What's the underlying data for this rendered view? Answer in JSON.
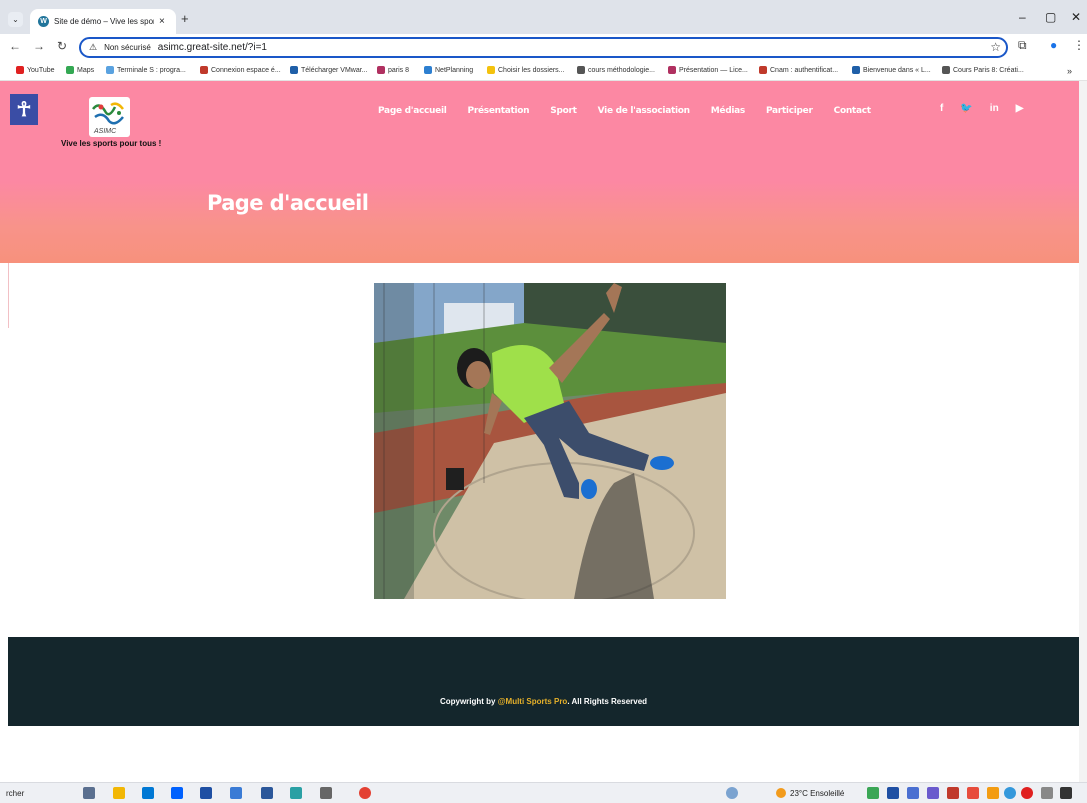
{
  "browser": {
    "tab_title": "Site de démo – Vive les sports p",
    "tab_close": "×",
    "new_tab": "+",
    "security_label": "Non sécurisé",
    "url": "asimc.great-site.net/?i=1",
    "bookmarks": [
      "YouTube",
      "Maps",
      "Terminale S : progra...",
      "Connexion espace é...",
      "Télécharger VMwar...",
      "paris 8",
      "NetPlanning",
      "Choisir les dossiers...",
      "cours méthodologie...",
      "Présentation — Lice...",
      "Cnam : authentificat...",
      "Bienvenue dans « L...",
      "Cours Paris 8: Créati..."
    ],
    "bookmarks_overflow": "»"
  },
  "site": {
    "logo_text": "ASIMC",
    "tagline": "Vive les sports pour tous !",
    "nav": [
      "Page d'accueil",
      "Présentation",
      "Sport",
      "Vie de l'association",
      "Médias",
      "Participer",
      "Contact"
    ],
    "social": [
      "f",
      "🐦",
      "in",
      "▶"
    ],
    "page_heading": "Page d'accueil",
    "photo_alt": "Athlète lançant un disque",
    "footer": {
      "prefix": "Copywright by ",
      "brand": "@Multi Sports Pro",
      "suffix": ". All Rights Reserved"
    }
  },
  "taskbar": {
    "search_fragment": "rcher",
    "weather": "23°C Ensoleillé"
  },
  "colors": {
    "hero_pink": "#fc88a3",
    "hero_salmon": "#f7917c",
    "footer_bg": "#14262c",
    "brand_gold": "#e5b02a",
    "a11y_blue": "#3a4da5"
  }
}
